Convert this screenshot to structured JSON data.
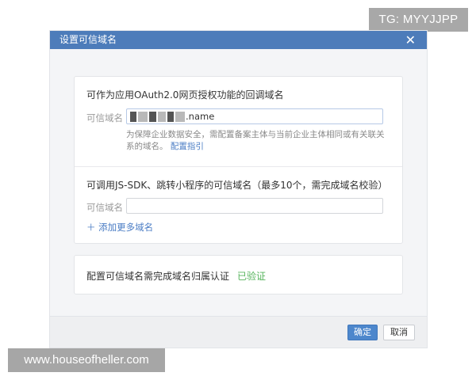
{
  "badge": {
    "text": "TG: MYYJJPP"
  },
  "dialog": {
    "title": "设置可信域名",
    "close_glyph": "✕",
    "oauth_section": {
      "title": "可作为应用OAuth2.0网页授权功能的回调域名",
      "field_label": "可信域名",
      "field_value_visible_suffix": ".name",
      "hint_text": "为保障企业数据安全，需配置备案主体与当前企业主体相同或有关联关系的域名。",
      "hint_link": "配置指引"
    },
    "jssdk_section": {
      "title": "可调用JS-SDK、跳转小程序的可信域名（最多10个，需完成域名校验）",
      "field_label": "可信域名",
      "field_value": "",
      "add_more": "＋ 添加更多域名"
    },
    "ownership": {
      "text": "配置可信域名需完成域名归属认证",
      "status": "已验证",
      "status_color": "#56b45c"
    },
    "footer": {
      "ok_label": "确定",
      "cancel_label": "取消"
    }
  },
  "watermark": {
    "text": "www.houseofheller.com"
  },
  "colors": {
    "header": "#4d7cba",
    "link": "#4a7cc4",
    "primary_button": "#4d87cc"
  }
}
